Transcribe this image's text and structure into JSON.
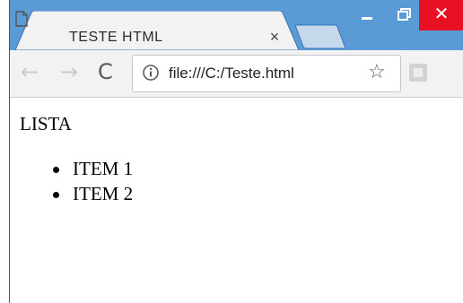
{
  "browser": {
    "tab": {
      "title": "TESTE HTML",
      "close_label": "×"
    },
    "window_controls": {
      "close_label": "✕"
    },
    "toolbar": {
      "back_label": "←",
      "forward_label": "→",
      "reload_label": "C",
      "url": "file:///C:/Teste.html",
      "star_label": "☆",
      "menu_label": "⋮"
    },
    "colors": {
      "titlebar": "#5b9bd5",
      "close_button": "#e81123",
      "toolbar": "#f2f2f2"
    }
  },
  "page": {
    "heading": "LISTA",
    "items": [
      "ITEM 1",
      "ITEM 2"
    ]
  }
}
